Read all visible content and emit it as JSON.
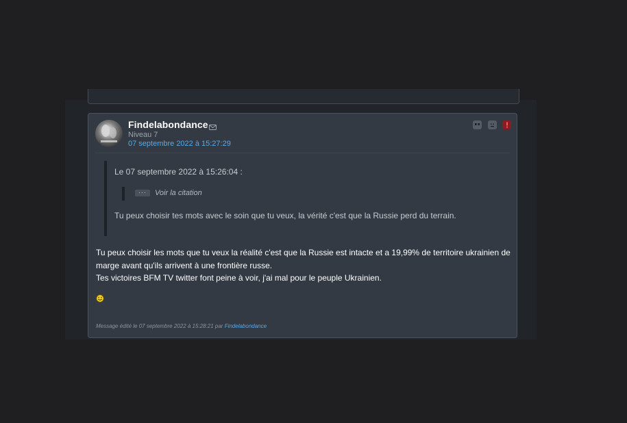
{
  "post": {
    "username": "Findelabondance",
    "level": "Niveau 7",
    "date": "07 septembre 2022 à 15:27:29",
    "quote": {
      "header": "Le 07 septembre 2022 à 15:26:04 :",
      "dots": "···",
      "see_quote_label": "Voir la citation",
      "body": "Tu peux choisir tes mots avec le soin que tu veux, la vérité c'est que la Russie perd du terrain."
    },
    "message": {
      "line1": "Tu peux choisir les mots que tu veux la réalité c'est que la Russie est intacte et a 19,99% de territoire ukrainien de marge avant qu'ils arrivent à une frontière russe.",
      "line2": "Tes victoires BFM TV twitter font peine à voir, j'ai mal pour le peuple Ukrainien."
    },
    "edit_note": {
      "prefix": "Message édité le 07 septembre 2022 à 15:28:21 par ",
      "author": "Findelabondance"
    }
  },
  "icons": {
    "mail": "mail-icon",
    "quote_action": "quote-icon",
    "emoji_action": "emoji-icon",
    "report_action": "alert-icon",
    "smiley": "smiley-icon"
  },
  "colors": {
    "page_bg": "#1f1f21",
    "card_bg": "#333a44",
    "link": "#59a9e6",
    "report": "#8a1c25"
  }
}
